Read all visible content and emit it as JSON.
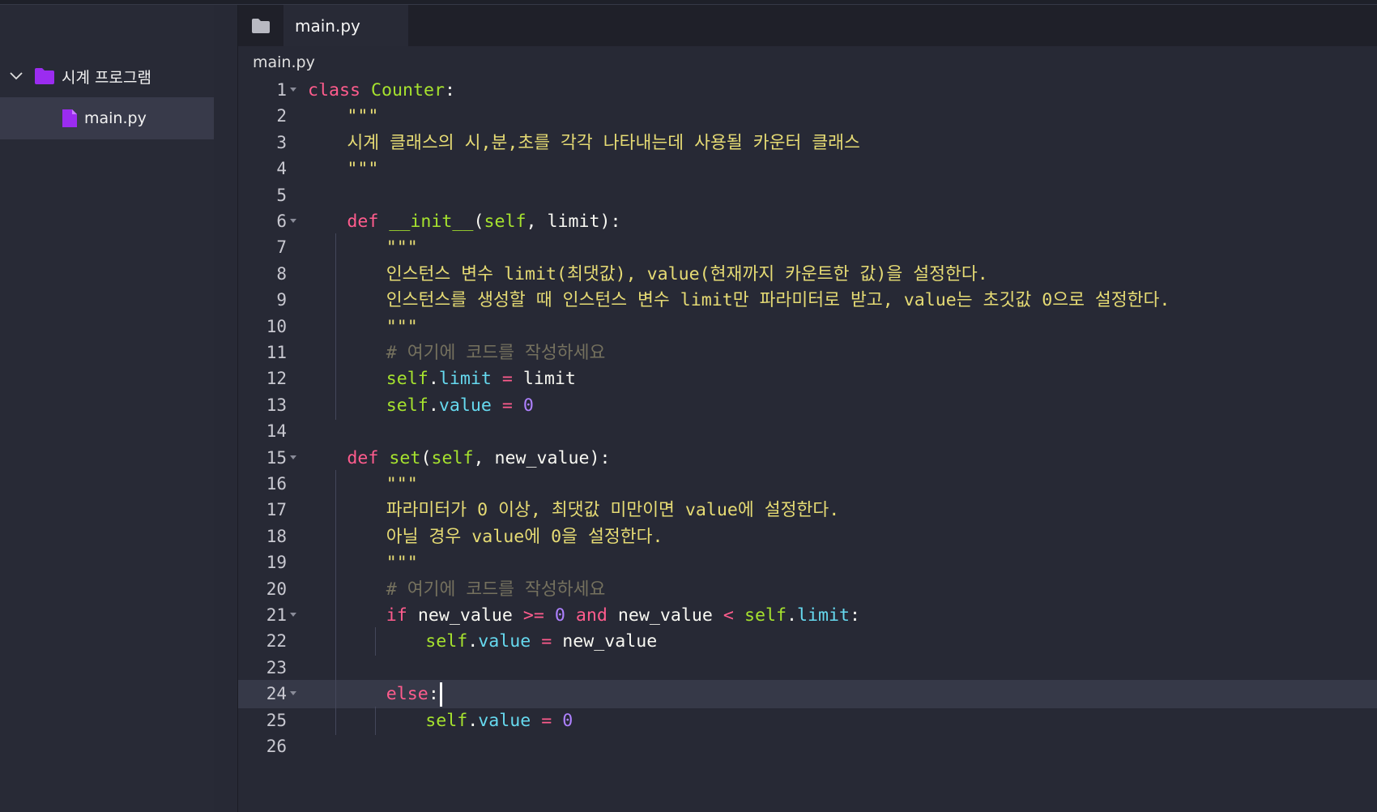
{
  "sidebar": {
    "folder": "시계 프로그램",
    "file": "main.py"
  },
  "tabs": {
    "active": "main.py"
  },
  "breadcrumb": "main.py",
  "editor": {
    "active_line": 24,
    "lines": [
      {
        "n": "1",
        "fold": true,
        "indent": 0,
        "tokens": [
          [
            "kw",
            "class"
          ],
          [
            "pl",
            " "
          ],
          [
            "cls",
            "Counter"
          ],
          [
            "pl",
            ":"
          ]
        ]
      },
      {
        "n": "2",
        "fold": false,
        "indent": 1,
        "tokens": [
          [
            "str",
            "\"\"\""
          ]
        ]
      },
      {
        "n": "3",
        "fold": false,
        "indent": 1,
        "tokens": [
          [
            "str",
            "시계 클래스의 시,분,초를 각각 나타내는데 사용될 카운터 클래스"
          ]
        ]
      },
      {
        "n": "4",
        "fold": false,
        "indent": 1,
        "tokens": [
          [
            "str",
            "\"\"\""
          ]
        ]
      },
      {
        "n": "5",
        "fold": false,
        "indent": 0,
        "tokens": []
      },
      {
        "n": "6",
        "fold": true,
        "indent": 1,
        "tokens": [
          [
            "kw",
            "def"
          ],
          [
            "pl",
            " "
          ],
          [
            "fn",
            "__init__"
          ],
          [
            "pl",
            "("
          ],
          [
            "self",
            "self"
          ],
          [
            "pl",
            ", limit):"
          ]
        ]
      },
      {
        "n": "7",
        "fold": false,
        "indent": 2,
        "tokens": [
          [
            "str",
            "\"\"\""
          ]
        ]
      },
      {
        "n": "8",
        "fold": false,
        "indent": 2,
        "tokens": [
          [
            "str",
            "인스턴스 변수 limit(최댓값), value(현재까지 카운트한 값)을 설정한다."
          ]
        ]
      },
      {
        "n": "9",
        "fold": false,
        "indent": 2,
        "tokens": [
          [
            "str",
            "인스턴스를 생성할 때 인스턴스 변수 limit만 파라미터로 받고, value는 초깃값 0으로 설정한다."
          ]
        ]
      },
      {
        "n": "10",
        "fold": false,
        "indent": 2,
        "tokens": [
          [
            "str",
            "\"\"\""
          ]
        ]
      },
      {
        "n": "11",
        "fold": false,
        "indent": 2,
        "tokens": [
          [
            "cm",
            "# 여기에 코드를 작성하세요"
          ]
        ]
      },
      {
        "n": "12",
        "fold": false,
        "indent": 2,
        "tokens": [
          [
            "self",
            "self"
          ],
          [
            "pl",
            "."
          ],
          [
            "attr",
            "limit"
          ],
          [
            "pl",
            " "
          ],
          [
            "op",
            "="
          ],
          [
            "pl",
            " limit"
          ]
        ]
      },
      {
        "n": "13",
        "fold": false,
        "indent": 2,
        "tokens": [
          [
            "self",
            "self"
          ],
          [
            "pl",
            "."
          ],
          [
            "attr",
            "value"
          ],
          [
            "pl",
            " "
          ],
          [
            "op",
            "="
          ],
          [
            "pl",
            " "
          ],
          [
            "num",
            "0"
          ]
        ]
      },
      {
        "n": "14",
        "fold": false,
        "indent": 0,
        "tokens": []
      },
      {
        "n": "15",
        "fold": true,
        "indent": 1,
        "tokens": [
          [
            "kw",
            "def"
          ],
          [
            "pl",
            " "
          ],
          [
            "fn",
            "set"
          ],
          [
            "pl",
            "("
          ],
          [
            "self",
            "self"
          ],
          [
            "pl",
            ", new_value):"
          ]
        ]
      },
      {
        "n": "16",
        "fold": false,
        "indent": 2,
        "tokens": [
          [
            "str",
            "\"\"\""
          ]
        ]
      },
      {
        "n": "17",
        "fold": false,
        "indent": 2,
        "tokens": [
          [
            "str",
            "파라미터가 0 이상, 최댓값 미만이면 value에 설정한다."
          ]
        ]
      },
      {
        "n": "18",
        "fold": false,
        "indent": 2,
        "tokens": [
          [
            "str",
            "아닐 경우 value에 0을 설정한다."
          ]
        ]
      },
      {
        "n": "19",
        "fold": false,
        "indent": 2,
        "tokens": [
          [
            "str",
            "\"\"\""
          ]
        ]
      },
      {
        "n": "20",
        "fold": false,
        "indent": 2,
        "tokens": [
          [
            "cm",
            "# 여기에 코드를 작성하세요"
          ]
        ]
      },
      {
        "n": "21",
        "fold": true,
        "indent": 2,
        "tokens": [
          [
            "kw",
            "if"
          ],
          [
            "pl",
            " new_value "
          ],
          [
            "op",
            ">="
          ],
          [
            "pl",
            " "
          ],
          [
            "num",
            "0"
          ],
          [
            "pl",
            " "
          ],
          [
            "kw",
            "and"
          ],
          [
            "pl",
            " new_value "
          ],
          [
            "op",
            "<"
          ],
          [
            "pl",
            " "
          ],
          [
            "self",
            "self"
          ],
          [
            "pl",
            "."
          ],
          [
            "attr",
            "limit"
          ],
          [
            "pl",
            ":"
          ]
        ]
      },
      {
        "n": "22",
        "fold": false,
        "indent": 3,
        "tokens": [
          [
            "self",
            "self"
          ],
          [
            "pl",
            "."
          ],
          [
            "attr",
            "value"
          ],
          [
            "pl",
            " "
          ],
          [
            "op",
            "="
          ],
          [
            "pl",
            " new_value"
          ]
        ]
      },
      {
        "n": "23",
        "fold": false,
        "indent": 2,
        "tokens": []
      },
      {
        "n": "24",
        "fold": true,
        "indent": 2,
        "tokens": [
          [
            "kw",
            "else"
          ],
          [
            "pl",
            ":"
          ]
        ]
      },
      {
        "n": "25",
        "fold": false,
        "indent": 3,
        "tokens": [
          [
            "self",
            "self"
          ],
          [
            "pl",
            "."
          ],
          [
            "attr",
            "value"
          ],
          [
            "pl",
            " "
          ],
          [
            "op",
            "="
          ],
          [
            "pl",
            " "
          ],
          [
            "num",
            "0"
          ]
        ]
      },
      {
        "n": "26",
        "fold": false,
        "indent": 0,
        "tokens": []
      }
    ]
  }
}
